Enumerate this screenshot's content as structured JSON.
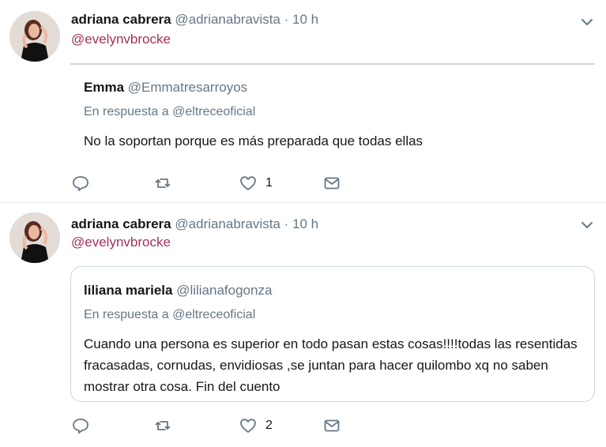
{
  "tweets": [
    {
      "author_name": "adriana cabrera",
      "author_handle": "@adrianabravista",
      "separator": "·",
      "time": "10 h",
      "mention": "@evelynvbrocke",
      "quoted": {
        "name": "Emma",
        "handle": "@Emmatresarroyos",
        "reply_prefix": "En respuesta a",
        "reply_to": "@eltreceoficial",
        "text": "No la soportan porque es más preparada que todas ellas"
      },
      "like_count": "1"
    },
    {
      "author_name": "adriana cabrera",
      "author_handle": "@adrianabravista",
      "separator": "·",
      "time": "10 h",
      "mention": "@evelynvbrocke",
      "quoted": {
        "name": "liliana mariela",
        "handle": "@lilianafogonza",
        "reply_prefix": "En respuesta a",
        "reply_to": "@eltreceoficial",
        "text": "Cuando una persona es superior en todo pasan estas cosas!!!!todas las resentidas fracasadas, cornudas, envidiosas ,se juntan para hacer quilombo xq no saben mostrar otra cosa. Fin del cuento"
      },
      "like_count": "2"
    }
  ],
  "colors": {
    "mention": "#a1325a",
    "secondary_text": "#657786",
    "border": "#ccd6dd"
  },
  "icons": [
    "chevron-down-icon",
    "reply-icon",
    "retweet-icon",
    "heart-icon",
    "envelope-icon"
  ]
}
